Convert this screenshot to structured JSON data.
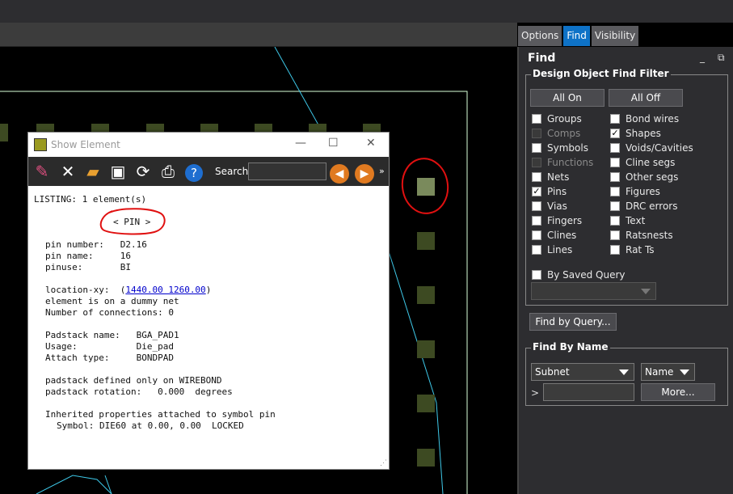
{
  "tabs": [
    "Options",
    "Find",
    "Visibility"
  ],
  "find_panel": {
    "title": "Find",
    "minimize_icon": "minimize-icon",
    "float_icon": "float-icon",
    "filter_group_title": "Design Object Find Filter",
    "all_on": "All On",
    "all_off": "All Off",
    "left_items": [
      {
        "label": "Groups",
        "checked": false,
        "disabled": false
      },
      {
        "label": "Comps",
        "checked": false,
        "disabled": true
      },
      {
        "label": "Symbols",
        "checked": false,
        "disabled": false
      },
      {
        "label": "Functions",
        "checked": false,
        "disabled": true
      },
      {
        "label": "Nets",
        "checked": false,
        "disabled": false
      },
      {
        "label": "Pins",
        "checked": true,
        "disabled": false
      },
      {
        "label": "Vias",
        "checked": false,
        "disabled": false
      },
      {
        "label": "Fingers",
        "checked": false,
        "disabled": false
      },
      {
        "label": "Clines",
        "checked": false,
        "disabled": false
      },
      {
        "label": "Lines",
        "checked": false,
        "disabled": false
      }
    ],
    "right_items": [
      {
        "label": "Bond wires",
        "checked": false,
        "disabled": false
      },
      {
        "label": "Shapes",
        "checked": true,
        "disabled": false
      },
      {
        "label": "Voids/Cavities",
        "checked": false,
        "disabled": false
      },
      {
        "label": "Cline segs",
        "checked": false,
        "disabled": false
      },
      {
        "label": "Other segs",
        "checked": false,
        "disabled": false
      },
      {
        "label": "Figures",
        "checked": false,
        "disabled": false
      },
      {
        "label": "DRC errors",
        "checked": false,
        "disabled": false
      },
      {
        "label": "Text",
        "checked": false,
        "disabled": false
      },
      {
        "label": "Ratsnests",
        "checked": false,
        "disabled": false
      },
      {
        "label": "Rat Ts",
        "checked": false,
        "disabled": false
      }
    ],
    "by_saved_query": "By Saved Query",
    "find_by_query": "Find by Query...",
    "find_by_name_title": "Find By Name",
    "type_select": "Subnet",
    "name_select": "Name",
    "prompt": ">",
    "more": "More..."
  },
  "dialog": {
    "title": "Show Element",
    "search_label": "Search:",
    "overflow": "»",
    "lines": [
      "LISTING: 1 element(s)",
      "< PIN >",
      "pin number:   D2.16",
      "pin name:     16",
      "pinuse:       BI",
      "location-xy:  (",
      "1440.00 1260.00",
      ")",
      "element is on a dummy net",
      "Number of connections: 0",
      "Padstack name:   BGA_PAD1",
      "Usage:           Die_pad",
      "Attach type:     BONDPAD",
      "padstack defined only on WIREBOND",
      "padstack rotation:   0.000  degrees",
      "Inherited properties attached to symbol pin",
      "Symbol: DIE60 at 0.00, 0.00  LOCKED"
    ]
  },
  "colors": {
    "accent": "#0e72c7",
    "pad": "#3d4a22",
    "highlight_pad": "#7a8a5c",
    "annotation": "#e01010",
    "trace": "#3ec8e8"
  }
}
